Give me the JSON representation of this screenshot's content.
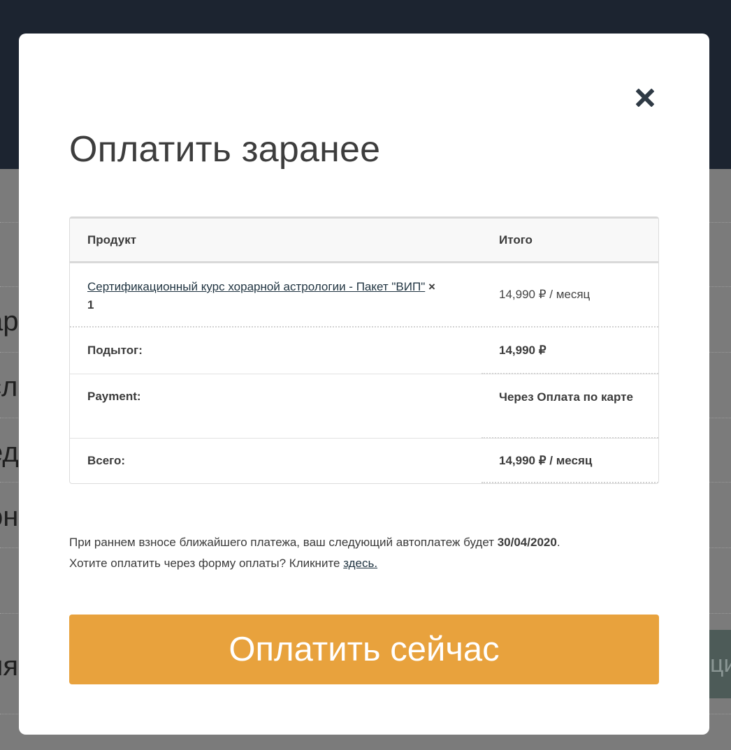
{
  "background": {
    "fragments": [
      "ар",
      "сл",
      "ед",
      "он",
      "ия",
      "ци"
    ]
  },
  "modal": {
    "close_icon": "close-icon",
    "title": "Оплатить заранее",
    "table": {
      "header": {
        "product": "Продукт",
        "total": "Итого"
      },
      "item": {
        "product_name": "Сертификационный курс хорарной астрологии - Пакет \"ВИП\"",
        "quantity_sign": "×",
        "quantity": "1",
        "price": "14,990 ₽ / месяц"
      },
      "subtotal": {
        "label": "Подытог:",
        "value": "14,990 ₽"
      },
      "payment": {
        "label": "Payment:",
        "value": "Через Оплата по карте"
      },
      "grand_total": {
        "label": "Всего:",
        "value": "14,990 ₽ / месяц"
      }
    },
    "note": {
      "line1_prefix": "При раннем взносе ближайшего платежа, ваш следующий автоплатеж будет ",
      "line1_date": "30/04/2020",
      "line1_suffix": ".",
      "line2_prefix": "Хотите оплатить через форму оплаты? Кликните ",
      "line2_link": "здесь."
    },
    "pay_button": "Оплатить сейчас"
  },
  "colors": {
    "header_bg": "#1c2430",
    "overlay": "#7b7b7b",
    "accent": "#e8a23d",
    "close_icon": "#2f3a45"
  }
}
